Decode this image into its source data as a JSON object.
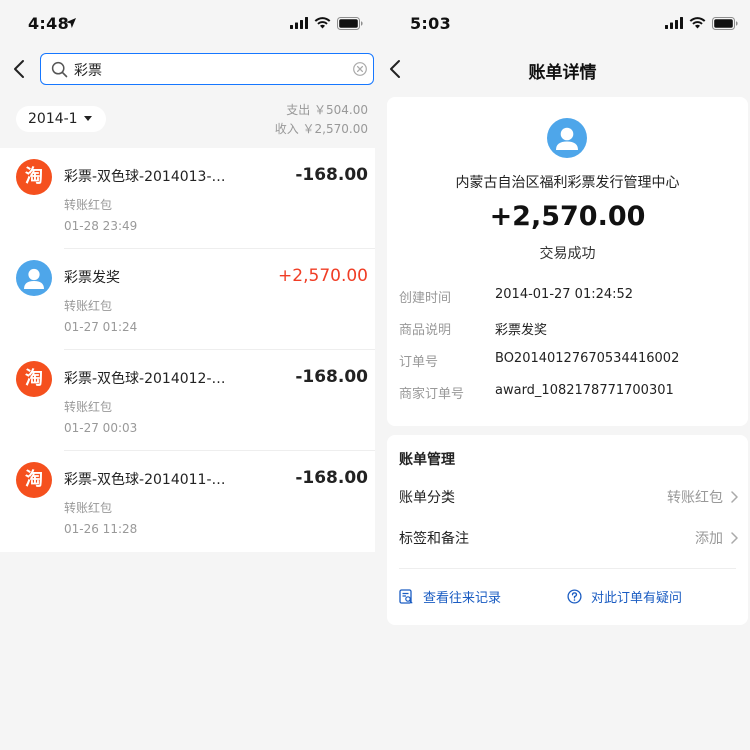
{
  "left": {
    "status_time": "4:48",
    "search": {
      "value": "彩票"
    },
    "month": "2014-1",
    "summary": {
      "out": "支出 ￥504.00",
      "in": "收入 ￥2,570.00"
    },
    "rows": [
      {
        "avatar": "淘",
        "title": "彩票-双色球-2014013-…",
        "sub": "转账红包",
        "time": "01-28 23:49",
        "amount": "-168.00",
        "type": "expense"
      },
      {
        "avatar": "user-icon",
        "title": "彩票发奖",
        "sub": "转账红包",
        "time": "01-27 01:24",
        "amount": "+2,570.00",
        "type": "income"
      },
      {
        "avatar": "淘",
        "title": "彩票-双色球-2014012-…",
        "sub": "转账红包",
        "time": "01-27 00:03",
        "amount": "-168.00",
        "type": "expense"
      },
      {
        "avatar": "淘",
        "title": "彩票-双色球-2014011-…",
        "sub": "转账红包",
        "time": "01-26 11:28",
        "amount": "-168.00",
        "type": "expense"
      }
    ]
  },
  "right": {
    "status_time": "5:03",
    "nav_title": "账单详情",
    "merchant": "内蒙古自治区福利彩票发行管理中心",
    "amount": "+2,570.00",
    "status": "交易成功",
    "details": [
      {
        "key": "创建时间",
        "value": "2014-01-27 01:24:52"
      },
      {
        "key": "商品说明",
        "value": "彩票发奖"
      },
      {
        "key": "订单号",
        "value": "BO20140127670534416002"
      },
      {
        "key": "商家订单号",
        "value": "award_1082178771700301"
      }
    ],
    "manage": {
      "title": "账单管理",
      "category_label": "账单分类",
      "category_value": "转账红包",
      "tags_label": "标签和备注",
      "tags_value": "添加",
      "history_action": "查看往来记录",
      "question_action": "对此订单有疑问"
    }
  },
  "colors": {
    "accent": "#1677ff",
    "link": "#1a5cc2",
    "income": "#f03d25",
    "taobao": "#f5501e",
    "avatar_blue": "#4ea6ea"
  }
}
